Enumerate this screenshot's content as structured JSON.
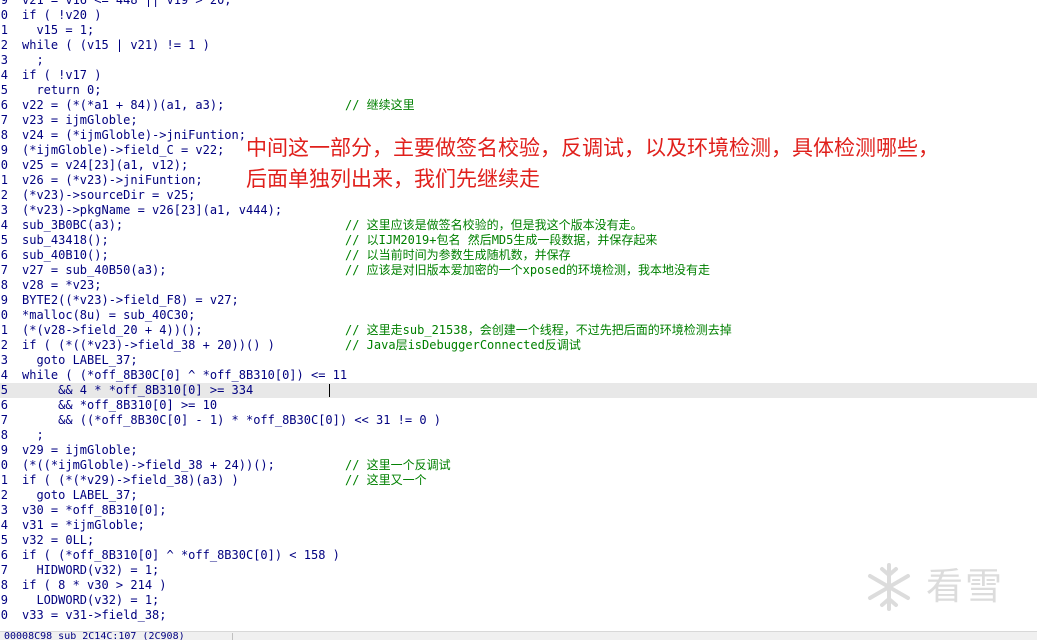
{
  "editor": {
    "lines": [
      {
        "code": "v21 = v16 <= 448 || v19 > 20;"
      },
      {
        "code": "if ( !v20 )"
      },
      {
        "code": "  v15 = 1;"
      },
      {
        "code": "while ( (v15 | v21) != 1 )"
      },
      {
        "code": "  ;"
      },
      {
        "code": "if ( !v17 )"
      },
      {
        "code": "  return 0;"
      },
      {
        "code": "v22 = (*(*a1 + 84))(a1, a3);",
        "comment": "// 继续这里"
      },
      {
        "code": "v23 = ijmGloble;"
      },
      {
        "code": "v24 = (*ijmGloble)->jniFuntion;"
      },
      {
        "code": "(*ijmGloble)->field_C = v22;"
      },
      {
        "code": "v25 = v24[23](a1, v12);"
      },
      {
        "code": "v26 = (*v23)->jniFuntion;"
      },
      {
        "code": "(*v23)->sourceDir = v25;"
      },
      {
        "code": "(*v23)->pkgName = v26[23](a1, v444);"
      },
      {
        "code": "sub_3B0BC(a3);",
        "comment": "// 这里应该是做签名校验的，但是我这个版本没有走。"
      },
      {
        "code": "sub_43418();",
        "comment": "// 以IJM2019+包名 然后MD5生成一段数据，并保存起来"
      },
      {
        "code": "sub_40B10();",
        "comment": "// 以当前时间为参数生成随机数，并保存"
      },
      {
        "code": "v27 = sub_40B50(a3);",
        "comment": "// 应该是对旧版本爱加密的一个xposed的环境检测，我本地没有走"
      },
      {
        "code": "v28 = *v23;"
      },
      {
        "code": "BYTE2((*v23)->field_F8) = v27;"
      },
      {
        "code": "*malloc(8u) = sub_40C30;"
      },
      {
        "code": "(*(v28->field_20 + 4))();",
        "comment": "// 这里走sub_21538，会创建一个线程，不过先把后面的环境检测去掉"
      },
      {
        "code": "if ( (*((*v23)->field_38 + 20))() )",
        "comment": "// Java层isDebuggerConnected反调试"
      },
      {
        "code": "  goto LABEL_37;"
      },
      {
        "code": "while ( (*off_8B30C[0] ^ *off_8B310[0]) <= 11"
      },
      {
        "code": "     && 4 * *off_8B310[0] >= 334",
        "current": true
      },
      {
        "code": "     && *off_8B310[0] >= 10"
      },
      {
        "code": "     && ((*off_8B30C[0] - 1) * *off_8B30C[0]) << 31 != 0 )"
      },
      {
        "code": "  ;"
      },
      {
        "code": "v29 = ijmGloble;"
      },
      {
        "code": "(*((*ijmGloble)->field_38 + 24))();",
        "comment": "// 这里一个反调试"
      },
      {
        "code": "if ( (*(*v29)->field_38)(a3) )",
        "comment": "// 这里又一个"
      },
      {
        "code": "  goto LABEL_37;"
      },
      {
        "code": "v30 = *off_8B310[0];"
      },
      {
        "code": "v31 = *ijmGloble;"
      },
      {
        "code": "v32 = 0LL;"
      },
      {
        "code": "if ( (*off_8B310[0] ^ *off_8B30C[0]) < 158 )"
      },
      {
        "code": "  HIDWORD(v32) = 1;"
      },
      {
        "code": "if ( 8 * v30 > 214 )"
      },
      {
        "code": "  LODWORD(v32) = 1;"
      },
      {
        "code": "v33 = v31->field_38;"
      }
    ],
    "gutter_digits": [
      "9",
      "0",
      "1",
      "2",
      "3",
      "4",
      "5",
      "6",
      "7",
      "8",
      "9",
      "0",
      "1",
      "2",
      "3",
      "4",
      "5",
      "6",
      "7",
      "8",
      "9",
      "0",
      "1",
      "2",
      "3",
      "4",
      "5",
      "6",
      "7",
      "8",
      "9",
      "0",
      "1",
      "2",
      "3",
      "4",
      "5",
      "6",
      "7",
      "8",
      "9",
      "0"
    ]
  },
  "annotation": {
    "line1": "中间这一部分，主要做签名校验，反调试，以及环境检测，具体检测哪些，",
    "line2": "后面单独列出来，我们先继续走",
    "color": "#e0201c"
  },
  "statusbar": {
    "text": "00008C98 sub_2C14C:107 (2C908)"
  },
  "watermark": {
    "text": "看雪",
    "icon": "snowflake-logo-icon"
  },
  "colors": {
    "code": "#000080",
    "comment": "#008000",
    "current_line": "#e8e8e8"
  }
}
